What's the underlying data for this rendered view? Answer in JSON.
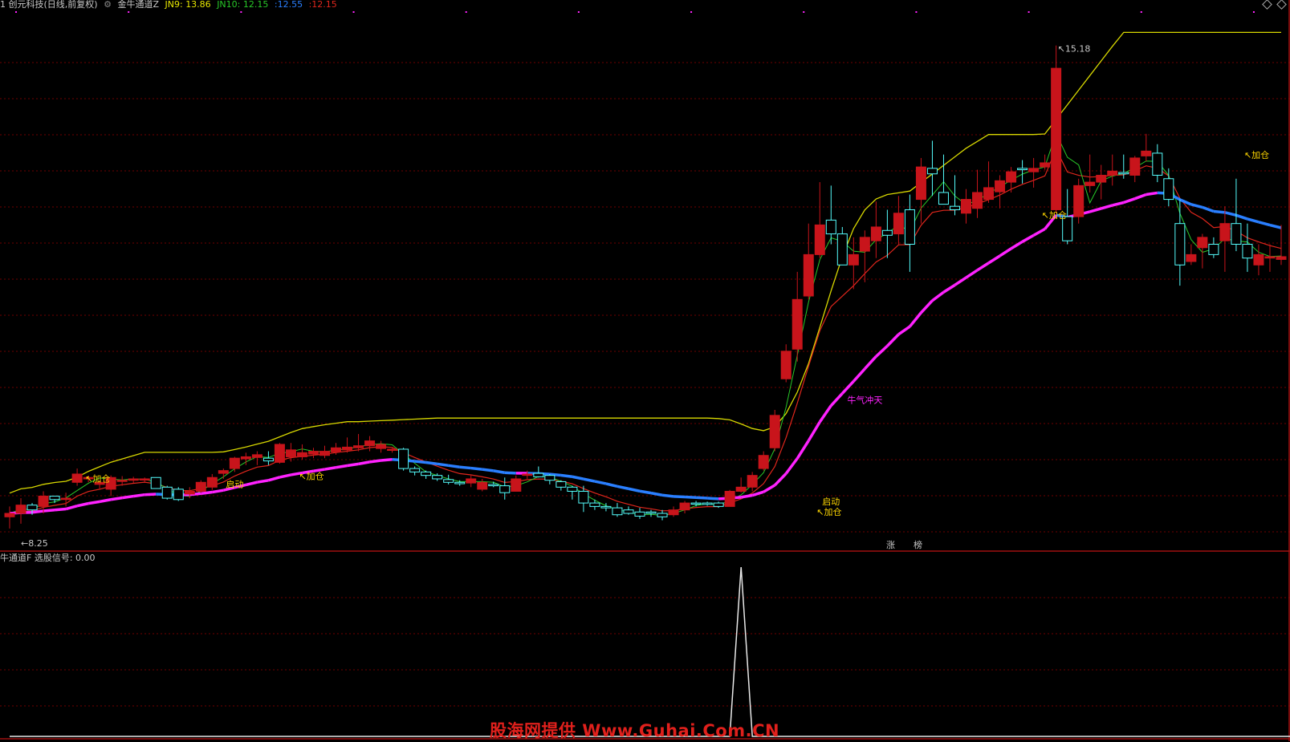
{
  "header": {
    "stock": "1 创元科技(日线,前复权)",
    "indicator_name": "金牛通道Z",
    "jn9_label": "JN9:",
    "jn9_value": "13.86",
    "jn10_label": "JN10:",
    "jn10_value": "12.15",
    "blue_value": ":12.55",
    "red_value": ":12.15"
  },
  "sub_header": {
    "indicator": "牛通道F",
    "signal_label": "选股信号:",
    "signal_value": "0.00"
  },
  "colors": {
    "up": "#c8141b",
    "down": "#54fcfc",
    "magenta": "#ff22ff",
    "blue": "#2a7fff",
    "yellow": "#d8d800",
    "red_line": "#e0261c",
    "green_line": "#28c828",
    "grid": "#700000",
    "label_yellow": "#ffd700"
  },
  "annotations": {
    "high_label": "15.18",
    "low_label": "8.25",
    "jiacang": "加仓",
    "qidong": "启动",
    "niuqi": "牛气冲天",
    "zhang": "涨",
    "bang": "榜"
  },
  "watermark": "股海网提供 Www.Guhai.Com.CN",
  "chart_data": [
    {
      "type": "candlestick",
      "ylim": [
        7.9,
        15.7
      ],
      "candles": [
        [
          8.35,
          8.5,
          8.18,
          8.4
        ],
        [
          8.4,
          8.62,
          8.25,
          8.52
        ],
        [
          8.52,
          8.55,
          8.38,
          8.45
        ],
        [
          8.5,
          8.72,
          8.4,
          8.65
        ],
        [
          8.65,
          8.6,
          8.55,
          8.6
        ],
        [
          8.6,
          8.7,
          8.5,
          8.62
        ],
        [
          8.85,
          9.05,
          8.8,
          8.97
        ],
        [
          8.9,
          8.95,
          8.85,
          8.92
        ],
        [
          8.82,
          8.88,
          8.76,
          8.85
        ],
        [
          8.75,
          8.95,
          8.65,
          8.92
        ],
        [
          8.88,
          8.94,
          8.8,
          8.88
        ],
        [
          8.88,
          8.93,
          8.84,
          8.9
        ],
        [
          8.9,
          8.92,
          8.86,
          8.9
        ],
        [
          8.92,
          8.9,
          8.8,
          8.76
        ],
        [
          8.78,
          8.8,
          8.6,
          8.62
        ],
        [
          8.75,
          8.78,
          8.58,
          8.6
        ],
        [
          8.68,
          8.78,
          8.62,
          8.72
        ],
        [
          8.72,
          8.88,
          8.7,
          8.85
        ],
        [
          8.78,
          8.97,
          8.74,
          8.92
        ],
        [
          8.98,
          9.05,
          8.9,
          9.02
        ],
        [
          9.05,
          9.22,
          9.0,
          9.2
        ],
        [
          9.19,
          9.28,
          9.1,
          9.22
        ],
        [
          9.21,
          9.3,
          9.1,
          9.25
        ],
        [
          9.2,
          9.3,
          9.1,
          9.16
        ],
        [
          9.14,
          9.42,
          9.12,
          9.4
        ],
        [
          9.22,
          9.42,
          9.15,
          9.32
        ],
        [
          9.22,
          9.4,
          9.18,
          9.28
        ],
        [
          9.26,
          9.35,
          9.2,
          9.3
        ],
        [
          9.24,
          9.38,
          9.2,
          9.3
        ],
        [
          9.29,
          9.42,
          9.25,
          9.35
        ],
        [
          9.32,
          9.5,
          9.28,
          9.36
        ],
        [
          9.35,
          9.55,
          9.3,
          9.38
        ],
        [
          9.38,
          9.52,
          9.3,
          9.45
        ],
        [
          9.34,
          9.45,
          9.28,
          9.4
        ],
        [
          9.32,
          9.36,
          9.28,
          9.33
        ],
        [
          9.33,
          9.35,
          9.02,
          9.05
        ],
        [
          9.05,
          9.08,
          8.95,
          9.0
        ],
        [
          9.0,
          9.02,
          8.9,
          8.95
        ],
        [
          8.95,
          8.98,
          8.87,
          8.9
        ],
        [
          8.89,
          8.96,
          8.82,
          8.85
        ],
        [
          8.85,
          8.88,
          8.8,
          8.83
        ],
        [
          8.84,
          8.95,
          8.78,
          8.9
        ],
        [
          8.75,
          8.9,
          8.72,
          8.85
        ],
        [
          8.82,
          8.86,
          8.78,
          8.8
        ],
        [
          8.8,
          8.92,
          8.6,
          8.7
        ],
        [
          8.72,
          8.95,
          8.72,
          8.9
        ],
        [
          8.95,
          9.02,
          8.9,
          8.97
        ],
        [
          8.98,
          9.08,
          8.92,
          8.93
        ],
        [
          8.95,
          8.97,
          8.82,
          8.88
        ],
        [
          8.86,
          8.88,
          8.73,
          8.78
        ],
        [
          8.78,
          8.8,
          8.6,
          8.72
        ],
        [
          8.72,
          8.8,
          8.42,
          8.55
        ],
        [
          8.55,
          8.6,
          8.45,
          8.5
        ],
        [
          8.5,
          8.55,
          8.43,
          8.48
        ],
        [
          8.48,
          8.55,
          8.35,
          8.38
        ],
        [
          8.45,
          8.5,
          8.38,
          8.4
        ],
        [
          8.42,
          8.48,
          8.32,
          8.36
        ],
        [
          8.42,
          8.45,
          8.35,
          8.4
        ],
        [
          8.4,
          8.45,
          8.3,
          8.35
        ],
        [
          8.38,
          8.5,
          8.35,
          8.45
        ],
        [
          8.45,
          8.58,
          8.4,
          8.55
        ],
        [
          8.55,
          8.58,
          8.5,
          8.54
        ],
        [
          8.55,
          8.57,
          8.51,
          8.53
        ],
        [
          8.55,
          8.57,
          8.48,
          8.5
        ],
        [
          8.5,
          8.74,
          8.5,
          8.72
        ],
        [
          8.72,
          8.92,
          8.7,
          8.78
        ],
        [
          8.78,
          9.0,
          8.72,
          8.95
        ],
        [
          9.05,
          9.3,
          9.02,
          9.24
        ],
        [
          9.35,
          9.9,
          9.3,
          9.82
        ],
        [
          10.35,
          10.85,
          10.3,
          10.75
        ],
        [
          10.78,
          11.9,
          10.6,
          11.5
        ],
        [
          11.55,
          12.6,
          11.5,
          12.15
        ],
        [
          12.15,
          13.2,
          12.1,
          12.58
        ],
        [
          12.65,
          13.15,
          12.3,
          12.45
        ],
        [
          12.45,
          12.55,
          12.0,
          12.0
        ],
        [
          12.0,
          12.4,
          11.65,
          12.15
        ],
        [
          12.2,
          12.5,
          11.75,
          12.4
        ],
        [
          12.35,
          12.92,
          12.1,
          12.55
        ],
        [
          12.5,
          12.8,
          12.1,
          12.43
        ],
        [
          12.45,
          13.0,
          12.3,
          12.75
        ],
        [
          12.8,
          13.02,
          11.9,
          12.3
        ],
        [
          12.95,
          13.55,
          12.6,
          13.42
        ],
        [
          13.4,
          13.8,
          13.0,
          13.32
        ],
        [
          13.05,
          13.6,
          12.95,
          12.88
        ],
        [
          12.85,
          13.3,
          12.72,
          12.8
        ],
        [
          12.75,
          13.1,
          12.6,
          12.95
        ],
        [
          12.82,
          13.38,
          12.68,
          13.05
        ],
        [
          12.95,
          13.5,
          12.9,
          13.12
        ],
        [
          13.06,
          13.3,
          12.82,
          13.22
        ],
        [
          13.2,
          13.42,
          13.05,
          13.35
        ],
        [
          13.4,
          13.52,
          13.18,
          13.38
        ],
        [
          13.35,
          13.55,
          13.12,
          13.4
        ],
        [
          13.42,
          13.6,
          13.38,
          13.48
        ],
        [
          12.8,
          15.18,
          12.75,
          14.85
        ],
        [
          12.7,
          13.1,
          12.3,
          12.35
        ],
        [
          12.7,
          13.25,
          12.6,
          13.15
        ],
        [
          13.15,
          13.6,
          13.05,
          13.2
        ],
        [
          13.2,
          13.45,
          12.95,
          13.3
        ],
        [
          13.3,
          13.6,
          13.15,
          13.36
        ],
        [
          13.34,
          13.6,
          13.25,
          13.32
        ],
        [
          13.3,
          13.58,
          13.2,
          13.55
        ],
        [
          13.58,
          13.9,
          13.5,
          13.65
        ],
        [
          13.62,
          13.75,
          13.2,
          13.3
        ],
        [
          13.25,
          13.4,
          12.85,
          12.95
        ],
        [
          12.6,
          12.95,
          11.7,
          12.0
        ],
        [
          12.05,
          12.3,
          12.0,
          12.15
        ],
        [
          12.25,
          12.45,
          11.95,
          12.4
        ],
        [
          12.3,
          12.4,
          12.1,
          12.15
        ],
        [
          12.35,
          12.85,
          11.9,
          12.6
        ],
        [
          12.6,
          13.25,
          12.2,
          12.3
        ],
        [
          12.3,
          12.6,
          11.9,
          12.1
        ],
        [
          12.0,
          12.3,
          11.85,
          12.15
        ],
        [
          12.1,
          12.3,
          11.9,
          12.12
        ],
        [
          12.08,
          12.58,
          12.0,
          12.12
        ]
      ]
    },
    {
      "type": "line",
      "name": "选股信号",
      "values": [
        0,
        0,
        0,
        0,
        0,
        0,
        0,
        0,
        0,
        0,
        0,
        0,
        0,
        0,
        0,
        0,
        0,
        0,
        0,
        0,
        0,
        0,
        0,
        0,
        0,
        0,
        0,
        0,
        0,
        0,
        0,
        0,
        0,
        0,
        0,
        0,
        0,
        0,
        0,
        0,
        0,
        0,
        0,
        0,
        0,
        0,
        0,
        0,
        0,
        0,
        0,
        0,
        0,
        0,
        0,
        0,
        0,
        0,
        0,
        0,
        0,
        0,
        0,
        0,
        0,
        1,
        0,
        0,
        0,
        0,
        0,
        0,
        0,
        0,
        0,
        0,
        0,
        0,
        0,
        0,
        0,
        0,
        0,
        0,
        0,
        0,
        0,
        0,
        0,
        0,
        0,
        0,
        0,
        0,
        0,
        0,
        0,
        0,
        0,
        0,
        0,
        0,
        0,
        0,
        0,
        0,
        0,
        0,
        0,
        0,
        0,
        0,
        0,
        0,
        0
      ],
      "current_value": 0.0
    }
  ]
}
